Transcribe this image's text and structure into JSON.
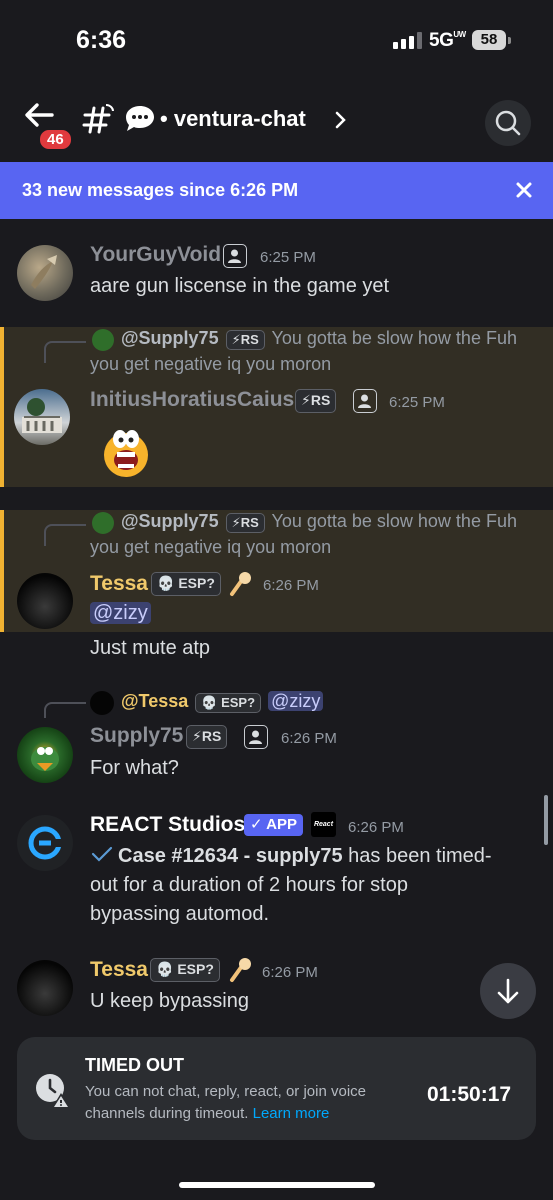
{
  "status": {
    "time": "6:36",
    "network": "5G",
    "network_sup": "UW",
    "battery": "58"
  },
  "header": {
    "unread_badge": "46",
    "channel_name": "ventura-chat"
  },
  "banner": {
    "text": "33 new messages since 6:26 PM"
  },
  "messages": [
    {
      "author": "YourGuyVoid",
      "time": "6:25 PM",
      "text": "aare gun liscense in the game yet"
    },
    {
      "reply_to": "@Supply75",
      "reply_tag": "⚡RS",
      "reply_text_1": "You gotta be slow how the Fuh",
      "reply_text_2": "you get negative iq you moron",
      "author": "InitiusHoratiusCaius",
      "tag": "⚡RS",
      "time": "6:25 PM"
    },
    {
      "reply_to": "@Supply75",
      "reply_tag": "⚡RS",
      "reply_text_1": "You gotta be slow how the Fuh",
      "reply_text_2": "you get negative iq you moron",
      "author": "Tessa",
      "tag": "💀 ESP?",
      "time": "6:26 PM",
      "mention": "@zizy",
      "text": "Just mute atp"
    },
    {
      "reply_to": "@Tessa",
      "reply_tag": "💀 ESP?",
      "reply_mention": "@zizy",
      "author": "Supply75",
      "tag": "⚡RS",
      "time": "6:26 PM",
      "text": "For what?"
    },
    {
      "author": "REACT Studios",
      "app_tag": "✓ APP",
      "server_tag": "React",
      "time": "6:26 PM",
      "text_bold": "Case #12634 - supply75",
      "text_1": "has been timed-",
      "text_2": "out for a duration of 2 hours for stop",
      "text_3": "bypassing automod."
    },
    {
      "author": "Tessa",
      "tag": "💀 ESP?",
      "time": "6:26 PM",
      "text": "U keep bypassing"
    }
  ],
  "timeout": {
    "title": "TIMED OUT",
    "desc_1": "You can not chat, reply, react, or join voice",
    "desc_2": "channels during timeout.",
    "link": "Learn more",
    "timer": "01:50:17"
  },
  "colors": {
    "accent": "#5865f2",
    "highlight_border": "#f0b232",
    "tessa": "#f0c96b",
    "mention_bg": "#3c4270",
    "link": "#00a8fc"
  },
  "icons": [
    "back-arrow-icon",
    "thread-hash-icon",
    "chat-bubble-icon",
    "chevron-right-icon",
    "search-icon",
    "close-icon",
    "user-icon",
    "mic-emoji-icon",
    "check-icon",
    "arrow-down-icon",
    "clock-warning-icon"
  ]
}
